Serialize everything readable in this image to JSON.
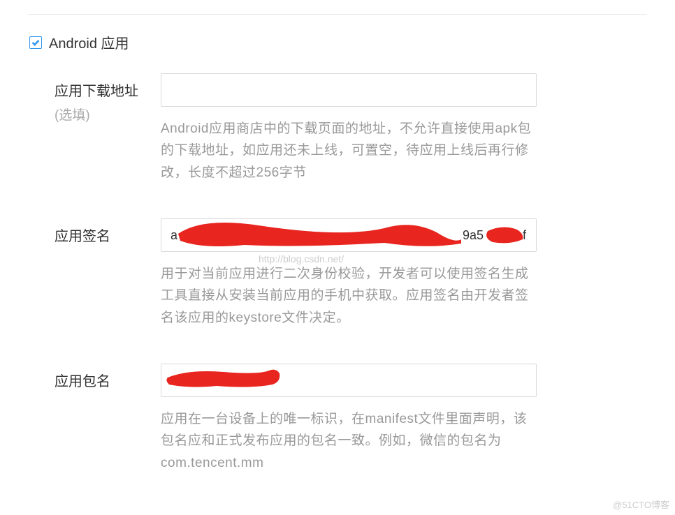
{
  "section": {
    "checked": true,
    "title": "Android 应用"
  },
  "fields": {
    "download": {
      "label": "应用下载地址",
      "optional": "(选填)",
      "value": "",
      "help": "Android应用商店中的下载页面的地址，不允许直接使用apk包的下载地址，如应用还未上线，可置空，待应用上线后再行修改，长度不超过256字节"
    },
    "signature": {
      "label": "应用签名",
      "value_prefix": "a",
      "value_mid": "9a5",
      "value_suffix": "f",
      "watermark": "http://blog.csdn.net/",
      "help": "用于对当前应用进行二次身份校验，开发者可以使用签名生成工具直接从安装当前应用的手机中获取。应用签名由开发者签名该应用的keystore文件决定。"
    },
    "package": {
      "label": "应用包名",
      "value": "",
      "help": "应用在一台设备上的唯一标识，在manifest文件里面声明，该包名应和正式发布应用的包名一致。例如，微信的包名为com.tencent.mm"
    }
  },
  "watermark": "@51CTO博客"
}
